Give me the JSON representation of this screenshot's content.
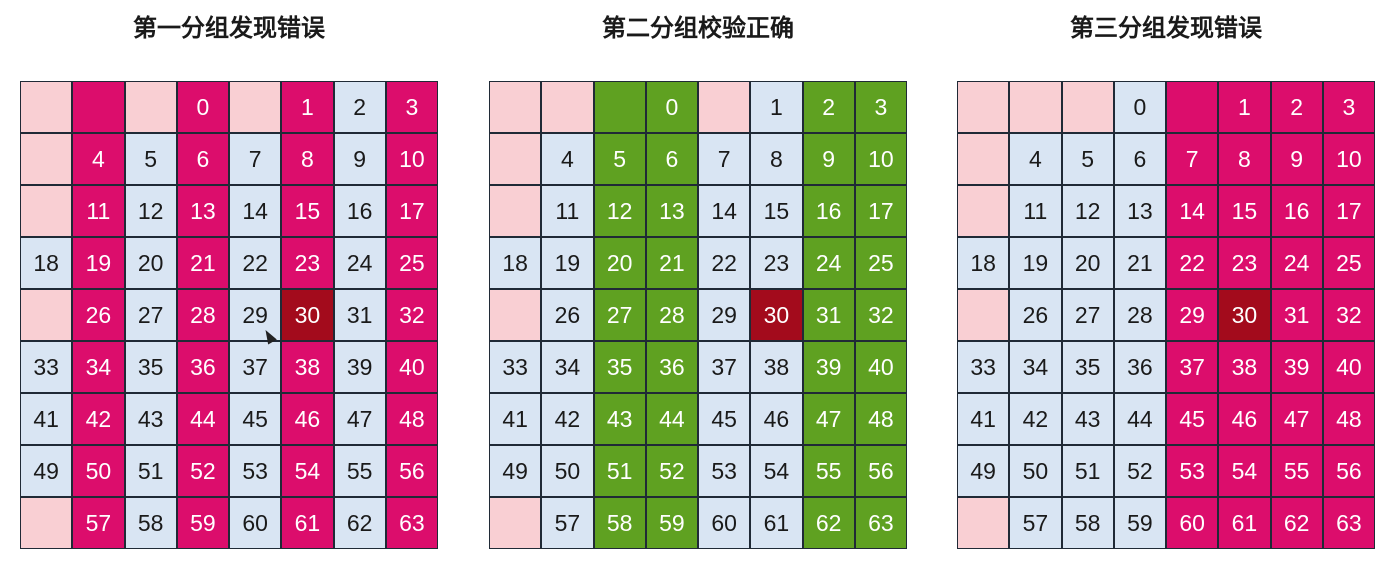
{
  "palette": {
    "blank": "#f9cfd3",
    "data": "#d9e5f3",
    "check_pink": "#dc0d6c",
    "check_green": "#5fa121",
    "error_cell": "#a30b1c"
  },
  "panels": [
    {
      "title": "第一分组发现错误",
      "rows": [
        [
          [
            "",
            "blank"
          ],
          [
            "",
            "check"
          ],
          [
            "",
            "blank"
          ],
          [
            "0",
            "check"
          ],
          [
            "",
            "blank"
          ],
          [
            "1",
            "check"
          ],
          [
            "2",
            "data"
          ],
          [
            "3",
            "check"
          ]
        ],
        [
          [
            "",
            "blank"
          ],
          [
            "4",
            "check"
          ],
          [
            "5",
            "data"
          ],
          [
            "6",
            "check"
          ],
          [
            "7",
            "data"
          ],
          [
            "8",
            "check"
          ],
          [
            "9",
            "data"
          ],
          [
            "10",
            "check"
          ]
        ],
        [
          [
            "",
            "blank"
          ],
          [
            "11",
            "check"
          ],
          [
            "12",
            "data"
          ],
          [
            "13",
            "check"
          ],
          [
            "14",
            "data"
          ],
          [
            "15",
            "check"
          ],
          [
            "16",
            "data"
          ],
          [
            "17",
            "check"
          ]
        ],
        [
          [
            "18",
            "data"
          ],
          [
            "19",
            "check"
          ],
          [
            "20",
            "data"
          ],
          [
            "21",
            "check"
          ],
          [
            "22",
            "data"
          ],
          [
            "23",
            "check"
          ],
          [
            "24",
            "data"
          ],
          [
            "25",
            "check"
          ]
        ],
        [
          [
            "",
            "blank"
          ],
          [
            "26",
            "check"
          ],
          [
            "27",
            "data"
          ],
          [
            "28",
            "check"
          ],
          [
            "29",
            "data"
          ],
          [
            "30",
            "error"
          ],
          [
            "31",
            "data"
          ],
          [
            "32",
            "check"
          ]
        ],
        [
          [
            "33",
            "data"
          ],
          [
            "34",
            "check"
          ],
          [
            "35",
            "data"
          ],
          [
            "36",
            "check"
          ],
          [
            "37",
            "data"
          ],
          [
            "38",
            "check"
          ],
          [
            "39",
            "data"
          ],
          [
            "40",
            "check"
          ]
        ],
        [
          [
            "41",
            "data"
          ],
          [
            "42",
            "check"
          ],
          [
            "43",
            "data"
          ],
          [
            "44",
            "check"
          ],
          [
            "45",
            "data"
          ],
          [
            "46",
            "check"
          ],
          [
            "47",
            "data"
          ],
          [
            "48",
            "check"
          ]
        ],
        [
          [
            "49",
            "data"
          ],
          [
            "50",
            "check"
          ],
          [
            "51",
            "data"
          ],
          [
            "52",
            "check"
          ],
          [
            "53",
            "data"
          ],
          [
            "54",
            "check"
          ],
          [
            "55",
            "data"
          ],
          [
            "56",
            "check"
          ]
        ],
        [
          [
            "",
            "blank"
          ],
          [
            "57",
            "check"
          ],
          [
            "58",
            "data"
          ],
          [
            "59",
            "check"
          ],
          [
            "60",
            "data"
          ],
          [
            "61",
            "check"
          ],
          [
            "62",
            "data"
          ],
          [
            "63",
            "check"
          ]
        ]
      ]
    },
    {
      "title": "第二分组校验正确",
      "rows": [
        [
          [
            "",
            "blank"
          ],
          [
            "",
            "blank"
          ],
          [
            "",
            "green"
          ],
          [
            "0",
            "green"
          ],
          [
            "",
            "blank"
          ],
          [
            "1",
            "data"
          ],
          [
            "2",
            "green"
          ],
          [
            "3",
            "green"
          ]
        ],
        [
          [
            "",
            "blank"
          ],
          [
            "4",
            "data"
          ],
          [
            "5",
            "green"
          ],
          [
            "6",
            "green"
          ],
          [
            "7",
            "data"
          ],
          [
            "8",
            "data"
          ],
          [
            "9",
            "green"
          ],
          [
            "10",
            "green"
          ]
        ],
        [
          [
            "",
            "blank"
          ],
          [
            "11",
            "data"
          ],
          [
            "12",
            "green"
          ],
          [
            "13",
            "green"
          ],
          [
            "14",
            "data"
          ],
          [
            "15",
            "data"
          ],
          [
            "16",
            "green"
          ],
          [
            "17",
            "green"
          ]
        ],
        [
          [
            "18",
            "data"
          ],
          [
            "19",
            "data"
          ],
          [
            "20",
            "green"
          ],
          [
            "21",
            "green"
          ],
          [
            "22",
            "data"
          ],
          [
            "23",
            "data"
          ],
          [
            "24",
            "green"
          ],
          [
            "25",
            "green"
          ]
        ],
        [
          [
            "",
            "blank"
          ],
          [
            "26",
            "data"
          ],
          [
            "27",
            "green"
          ],
          [
            "28",
            "green"
          ],
          [
            "29",
            "data"
          ],
          [
            "30",
            "error"
          ],
          [
            "31",
            "green"
          ],
          [
            "32",
            "green"
          ]
        ],
        [
          [
            "33",
            "data"
          ],
          [
            "34",
            "data"
          ],
          [
            "35",
            "green"
          ],
          [
            "36",
            "green"
          ],
          [
            "37",
            "data"
          ],
          [
            "38",
            "data"
          ],
          [
            "39",
            "green"
          ],
          [
            "40",
            "green"
          ]
        ],
        [
          [
            "41",
            "data"
          ],
          [
            "42",
            "data"
          ],
          [
            "43",
            "green"
          ],
          [
            "44",
            "green"
          ],
          [
            "45",
            "data"
          ],
          [
            "46",
            "data"
          ],
          [
            "47",
            "green"
          ],
          [
            "48",
            "green"
          ]
        ],
        [
          [
            "49",
            "data"
          ],
          [
            "50",
            "data"
          ],
          [
            "51",
            "green"
          ],
          [
            "52",
            "green"
          ],
          [
            "53",
            "data"
          ],
          [
            "54",
            "data"
          ],
          [
            "55",
            "green"
          ],
          [
            "56",
            "green"
          ]
        ],
        [
          [
            "",
            "blank"
          ],
          [
            "57",
            "data"
          ],
          [
            "58",
            "green"
          ],
          [
            "59",
            "green"
          ],
          [
            "60",
            "data"
          ],
          [
            "61",
            "data"
          ],
          [
            "62",
            "green"
          ],
          [
            "63",
            "green"
          ]
        ]
      ]
    },
    {
      "title": "第三分组发现错误",
      "rows": [
        [
          [
            "",
            "blank"
          ],
          [
            "",
            "blank"
          ],
          [
            "",
            "blank"
          ],
          [
            "0",
            "data"
          ],
          [
            "",
            "check"
          ],
          [
            "1",
            "check"
          ],
          [
            "2",
            "check"
          ],
          [
            "3",
            "check"
          ]
        ],
        [
          [
            "",
            "blank"
          ],
          [
            "4",
            "data"
          ],
          [
            "5",
            "data"
          ],
          [
            "6",
            "data"
          ],
          [
            "7",
            "check"
          ],
          [
            "8",
            "check"
          ],
          [
            "9",
            "check"
          ],
          [
            "10",
            "check"
          ]
        ],
        [
          [
            "",
            "blank"
          ],
          [
            "11",
            "data"
          ],
          [
            "12",
            "data"
          ],
          [
            "13",
            "data"
          ],
          [
            "14",
            "check"
          ],
          [
            "15",
            "check"
          ],
          [
            "16",
            "check"
          ],
          [
            "17",
            "check"
          ]
        ],
        [
          [
            "18",
            "data"
          ],
          [
            "19",
            "data"
          ],
          [
            "20",
            "data"
          ],
          [
            "21",
            "data"
          ],
          [
            "22",
            "check"
          ],
          [
            "23",
            "check"
          ],
          [
            "24",
            "check"
          ],
          [
            "25",
            "check"
          ]
        ],
        [
          [
            "",
            "blank"
          ],
          [
            "26",
            "data"
          ],
          [
            "27",
            "data"
          ],
          [
            "28",
            "data"
          ],
          [
            "29",
            "check"
          ],
          [
            "30",
            "error"
          ],
          [
            "31",
            "check"
          ],
          [
            "32",
            "check"
          ]
        ],
        [
          [
            "33",
            "data"
          ],
          [
            "34",
            "data"
          ],
          [
            "35",
            "data"
          ],
          [
            "36",
            "data"
          ],
          [
            "37",
            "check"
          ],
          [
            "38",
            "check"
          ],
          [
            "39",
            "check"
          ],
          [
            "40",
            "check"
          ]
        ],
        [
          [
            "41",
            "data"
          ],
          [
            "42",
            "data"
          ],
          [
            "43",
            "data"
          ],
          [
            "44",
            "data"
          ],
          [
            "45",
            "check"
          ],
          [
            "46",
            "check"
          ],
          [
            "47",
            "check"
          ],
          [
            "48",
            "check"
          ]
        ],
        [
          [
            "49",
            "data"
          ],
          [
            "50",
            "data"
          ],
          [
            "51",
            "data"
          ],
          [
            "52",
            "data"
          ],
          [
            "53",
            "check"
          ],
          [
            "54",
            "check"
          ],
          [
            "55",
            "check"
          ],
          [
            "56",
            "check"
          ]
        ],
        [
          [
            "",
            "blank"
          ],
          [
            "57",
            "data"
          ],
          [
            "58",
            "data"
          ],
          [
            "59",
            "data"
          ],
          [
            "60",
            "check"
          ],
          [
            "61",
            "check"
          ],
          [
            "62",
            "check"
          ],
          [
            "63",
            "check"
          ]
        ]
      ]
    }
  ]
}
